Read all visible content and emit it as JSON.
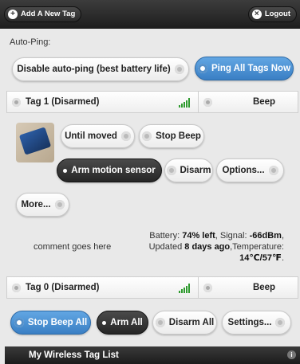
{
  "toolbar": {
    "add_tag_label": "Add A New Tag",
    "logout_label": "Logout"
  },
  "autoping": {
    "label": "Auto-Ping:",
    "disable_label": "Disable auto-ping (best battery life)",
    "ping_all_label": "Ping All Tags Now"
  },
  "tags": [
    {
      "name": "Tag 1 (Disarmed)",
      "beep_label": "Beep",
      "actions": {
        "until_moved": "Until moved",
        "stop_beep": "Stop Beep",
        "arm_motion": "Arm motion sensor",
        "disarm": "Disarm",
        "options": "Options...",
        "more": "More..."
      },
      "comment": "comment goes here",
      "status": {
        "battery_prefix": "Battery: ",
        "battery": "74% left",
        "signal_prefix": ", Signal: ",
        "signal": "-66dBm",
        "updated_prefix": ", Updated ",
        "updated": "8 days ago",
        "temp_prefix": ",Temperature: ",
        "temperature": "14℃/57℉",
        "temp_suffix": "."
      }
    },
    {
      "name": "Tag 0 (Disarmed)",
      "beep_label": "Beep"
    }
  ],
  "bottom_actions": {
    "stop_beep_all": "Stop Beep All",
    "arm_all": "Arm All",
    "disarm_all": "Disarm All",
    "settings": "Settings..."
  },
  "footer": {
    "title": "My Wireless Tag List",
    "info_icon_glyph": "i"
  },
  "colors": {
    "accent_blue": "#3a7fc4",
    "dark": "#262626",
    "signal_green": "#2f9b2f"
  }
}
